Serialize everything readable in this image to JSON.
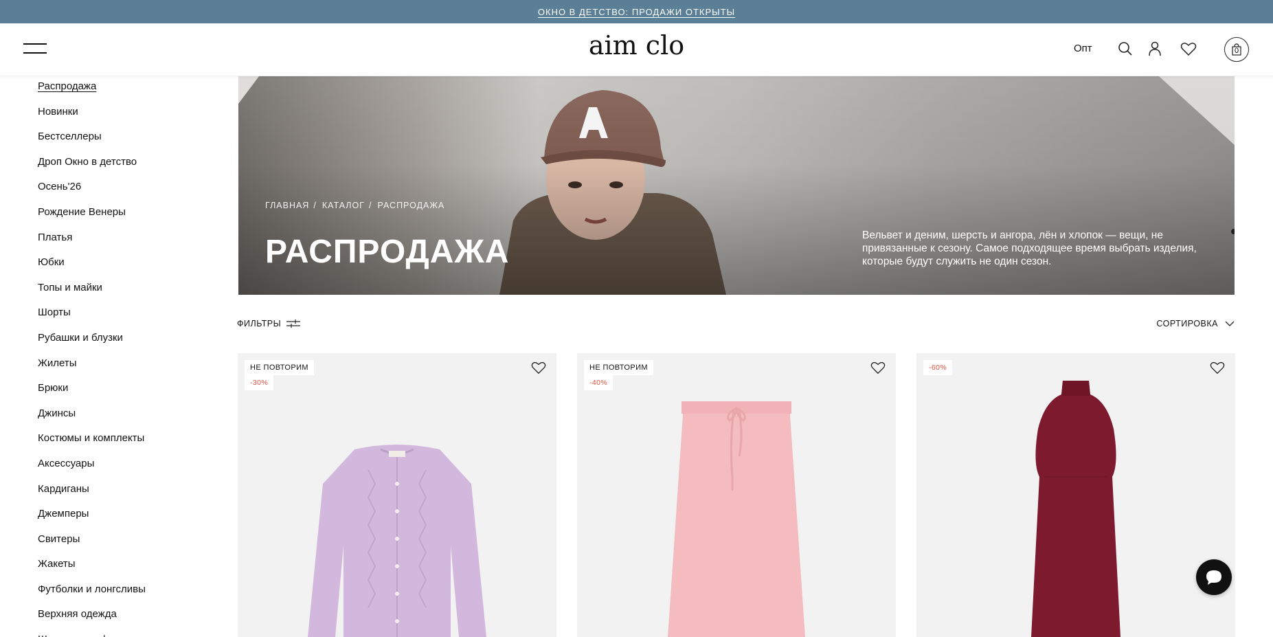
{
  "announcement": {
    "text": "ОКНО В ДЕТСТВО: ПРОДАЖИ ОТКРЫТЫ"
  },
  "header": {
    "logo": "aim clo",
    "opt_label": "Опт",
    "cart_count": "0",
    "icons": [
      "menu-icon",
      "search-icon",
      "user-icon",
      "heart-icon",
      "cart-icon"
    ]
  },
  "sidebar": {
    "items": [
      {
        "label": "Распродажа",
        "active": true
      },
      {
        "label": "Новинки"
      },
      {
        "label": "Бестселлеры"
      },
      {
        "label": "Дроп Окно в детство"
      },
      {
        "label": "Осень'26"
      },
      {
        "label": "Рождение Венеры"
      },
      {
        "label": "Платья"
      },
      {
        "label": "Юбки"
      },
      {
        "label": "Топы и майки"
      },
      {
        "label": "Шорты"
      },
      {
        "label": "Рубашки и блузки"
      },
      {
        "label": "Жилеты"
      },
      {
        "label": "Брюки"
      },
      {
        "label": "Джинсы"
      },
      {
        "label": "Костюмы и комплекты"
      },
      {
        "label": "Аксессуары"
      },
      {
        "label": "Кардиганы"
      },
      {
        "label": "Джемперы"
      },
      {
        "label": "Свитеры"
      },
      {
        "label": "Жакеты"
      },
      {
        "label": "Футболки и лонгсливы"
      },
      {
        "label": "Верхняя одежда"
      },
      {
        "label": "Шапки и шарфы"
      }
    ]
  },
  "hero": {
    "breadcrumbs": [
      "ГЛАВНАЯ",
      "КАТАЛОГ",
      "РАСПРОДАЖА"
    ],
    "breadcrumb_separator": "/",
    "title": "РАСПРОДАЖА",
    "description": "Вельвет и деним, шерсть и ангора, лён и хлопок — вещи, не привязанные к сезону. Самое подходящее время выбрать изделия, которые будут служить не один сезон."
  },
  "controls": {
    "filters_label": "ФИЛЬТРЫ",
    "sort_label": "СОРТИРОВКА"
  },
  "products": [
    {
      "badge": "НЕ ПОВТОРИМ",
      "discount": "-30%",
      "item": "cardigan",
      "color": "#d3b8dd"
    },
    {
      "badge": "НЕ ПОВТОРИМ",
      "discount": "-40%",
      "item": "knit-skirt",
      "color": "#f4bcbf"
    },
    {
      "badge": "",
      "discount": "-60%",
      "item": "knit-dress",
      "color": "#7d1a2e"
    }
  ],
  "colors": {
    "announcement_bg": "#5b7f96",
    "discount_text": "#e0503c",
    "card_bg": "#f2f2f2"
  }
}
